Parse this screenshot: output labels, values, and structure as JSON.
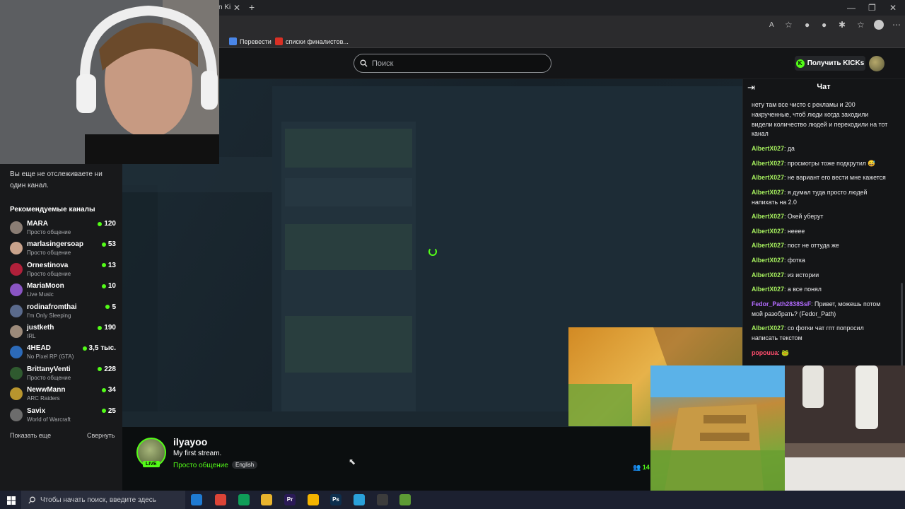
{
  "browser": {
    "tab_fragment": "n Ki",
    "bookmarks": [
      {
        "label": "Перевести",
        "icon": "translate-icon",
        "color": "#4a86e8"
      },
      {
        "label": "списки финалистов...",
        "icon": "bookmark-favicon-icon",
        "color": "#d93025"
      }
    ]
  },
  "header": {
    "search_placeholder": "Поиск",
    "kicks_button": "Получить KICKs"
  },
  "sidebar": {
    "not_following": "Вы еще не отслеживаете ни один канал.",
    "recommended_title": "Рекомендуемые каналы",
    "channels": [
      {
        "name": "MARA",
        "category": "Просто общение",
        "viewers": "120",
        "color": "#8a7d74"
      },
      {
        "name": "marlasingersoap",
        "category": "Просто общение",
        "viewers": "53",
        "color": "#c9a38c"
      },
      {
        "name": "Ornestinova",
        "category": "Просто общение",
        "viewers": "13",
        "color": "#b0203a"
      },
      {
        "name": "MariaMoon",
        "category": "Live Music",
        "viewers": "10",
        "color": "#8a55c4"
      },
      {
        "name": "rodinafromthai",
        "category": "I'm Only Sleeping",
        "viewers": "5",
        "color": "#5a6a8c"
      },
      {
        "name": "justketh",
        "category": "IRL",
        "viewers": "190",
        "color": "#9c8a7a"
      },
      {
        "name": "4HEAD",
        "category": "No Pixel RP (GTA)",
        "viewers": "3,5 тыс.",
        "color": "#2c6ab8"
      },
      {
        "name": "BrittanyVenti",
        "category": "Просто общение",
        "viewers": "228",
        "color": "#2f5a2f"
      },
      {
        "name": "NewwMann",
        "category": "ARC Raiders",
        "viewers": "34",
        "color": "#b8952e"
      },
      {
        "name": "Savix",
        "category": "World of Warcraft",
        "viewers": "25",
        "color": "#6c6c6c"
      }
    ],
    "show_more": "Показать еще",
    "collapse": "Свернуть"
  },
  "stream": {
    "streamer": "ilyayoo",
    "title": "My first stream.",
    "category": "Просто общение",
    "language": "English",
    "live_badge": "LIVE",
    "viewers_partial": "14"
  },
  "chat": {
    "title": "Чат",
    "messages": [
      {
        "user": "",
        "color": "#e9e9eb",
        "text": "нету там все чисто с рекламы и 200 накрученные, чтоб люди когда заходили видели количество людей и переходили на тот канал"
      },
      {
        "user": "AlbertX027",
        "color": "#a6f05e",
        "text": "да"
      },
      {
        "user": "AlbertX027",
        "color": "#a6f05e",
        "text": "просмотры тоже подкрутил 😅"
      },
      {
        "user": "AlbertX027",
        "color": "#a6f05e",
        "text": "не вариант его вести мне кажется"
      },
      {
        "user": "AlbertX027",
        "color": "#a6f05e",
        "text": "я думал туда просто людей напихать на 2.0"
      },
      {
        "user": "AlbertX027",
        "color": "#a6f05e",
        "text": "Окей уберут"
      },
      {
        "user": "AlbertX027",
        "color": "#a6f05e",
        "text": "нееее"
      },
      {
        "user": "AlbertX027",
        "color": "#a6f05e",
        "text": "пост не оттуда же"
      },
      {
        "user": "AlbertX027",
        "color": "#a6f05e",
        "text": "фотка"
      },
      {
        "user": "AlbertX027",
        "color": "#a6f05e",
        "text": "из истории"
      },
      {
        "user": "AlbertX027",
        "color": "#a6f05e",
        "text": "а все понял"
      },
      {
        "user": "Fedor_Path2838SsF",
        "color": "#b36bff",
        "text": "Привет, можешь потом мой разобрать? (Fedor_Path)"
      },
      {
        "user": "AlbertX027",
        "color": "#a6f05e",
        "text": "со фотки чат гпт попросил написать текстом"
      },
      {
        "user": "popouua",
        "color": "#ff4d6d",
        "text": "🐸"
      }
    ]
  },
  "taskbar": {
    "search_placeholder": "Чтобы начать поиск, введите здесь",
    "apps": [
      {
        "name": "edge-icon",
        "label": "",
        "color": "#1f7ad1"
      },
      {
        "name": "chrome-icon",
        "label": "",
        "color": "#db4437"
      },
      {
        "name": "chrome-icon-2",
        "label": "",
        "color": "#0f9d58"
      },
      {
        "name": "folder-icon",
        "label": "",
        "color": "#e8b32d"
      },
      {
        "name": "premiere-icon",
        "label": "Pr",
        "color": "#2a1a56"
      },
      {
        "name": "chrome-icon-3",
        "label": "",
        "color": "#f4b400"
      },
      {
        "name": "photoshop-icon",
        "label": "Ps",
        "color": "#0d2f4e"
      },
      {
        "name": "telegram-icon",
        "label": "",
        "color": "#2aa1da"
      },
      {
        "name": "obs-icon",
        "label": "",
        "color": "#3c3c3c"
      },
      {
        "name": "minecraft-icon",
        "label": "",
        "color": "#5d9b35"
      }
    ]
  }
}
